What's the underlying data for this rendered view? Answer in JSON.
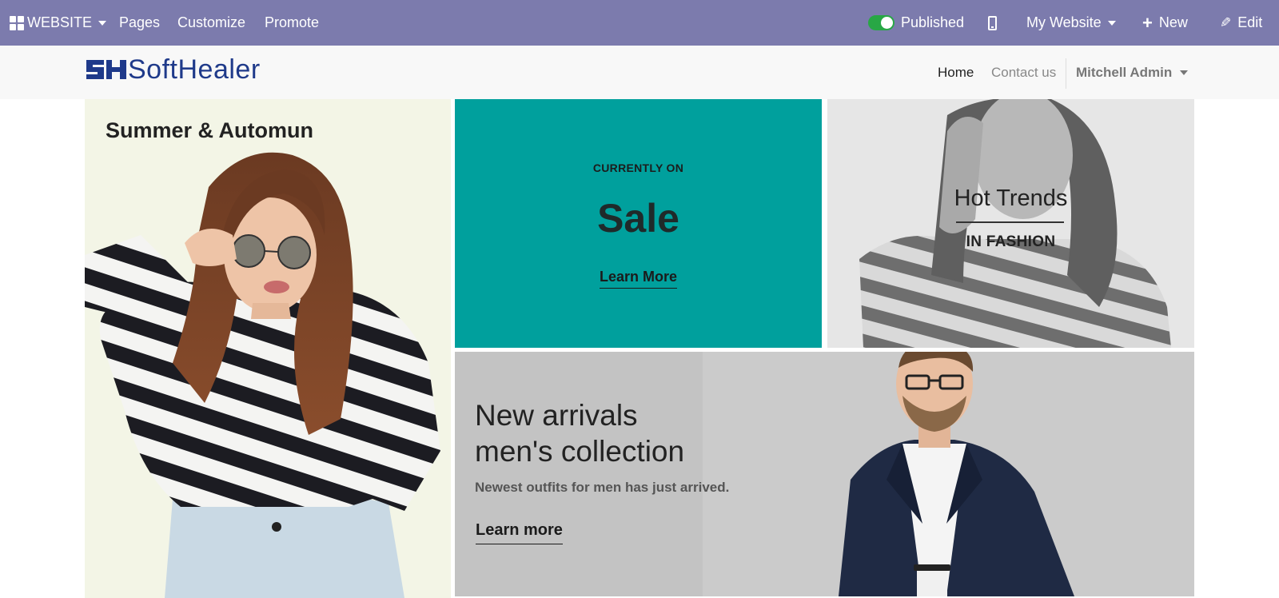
{
  "adminbar": {
    "app_label": "WEBSITE",
    "menu": [
      "Pages",
      "Customize",
      "Promote"
    ],
    "published_label": "Published",
    "website_selector": "My Website",
    "new_label": "New",
    "edit_label": "Edit",
    "colors": {
      "background": "#7c7bad",
      "toggle_on": "#28a745"
    }
  },
  "header": {
    "logo_text": "SoftHealer",
    "nav": {
      "home": "Home",
      "contact": "Contact us",
      "user": "Mitchell Admin"
    }
  },
  "hero": {
    "left": {
      "title": "Summer & Automun"
    },
    "sale": {
      "kicker": "CURRENTLY ON",
      "title": "Sale",
      "link": "Learn More",
      "bg": "#00a09d"
    },
    "trends": {
      "title": "Hot Trends",
      "subtitle": "IN FASHION"
    },
    "men": {
      "title_line1": "New arrivals",
      "title_line2": "men's collection",
      "subtitle": "Newest outfits for men has just arrived.",
      "link": "Learn more"
    }
  }
}
